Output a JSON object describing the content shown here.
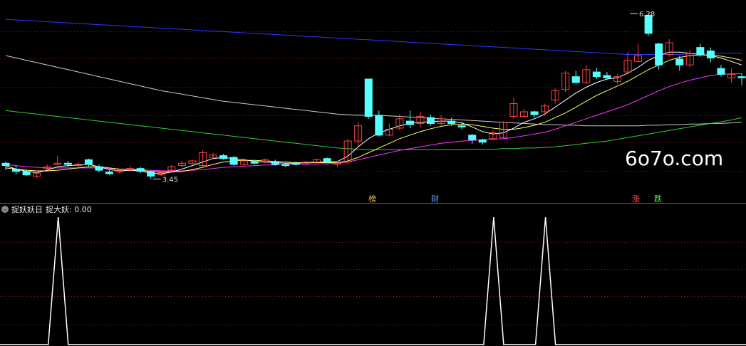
{
  "indicator": {
    "name": "捉妖妖日",
    "value_label": "捉大妖: 0.00"
  },
  "watermark": "6o7o.com",
  "tags": [
    {
      "text": "榜",
      "color": "#ffb84d"
    },
    {
      "text": "财",
      "color": "#5aa7ff"
    },
    {
      "text": "涨",
      "color": "#ff4d4d"
    },
    {
      "text": "跌",
      "color": "#4dff4d"
    }
  ],
  "colors": {
    "up": "#ff4040",
    "down": "#55ffff",
    "ma_fast": "#ffffff",
    "ma_mid": "#ffff66",
    "ma_slow": "#ff33ff",
    "ma_green": "#33cc33",
    "ma_gray": "#cccccc",
    "ma_blue": "#3333ff",
    "grid": "#8b1a1a",
    "signal": "#ffffff"
  },
  "chart_data": [
    {
      "type": "candlestick",
      "title": "",
      "y_range": [
        3.2,
        6.45
      ],
      "annotations": [
        {
          "text": "6.28",
          "value": 6.28,
          "bar": 60
        },
        {
          "text": "3.45",
          "value": 3.45,
          "bar": 14
        }
      ],
      "candles": [
        [
          3.72,
          3.68,
          3.75,
          3.6
        ],
        [
          3.62,
          3.58,
          3.68,
          3.52
        ],
        [
          3.58,
          3.52,
          3.62,
          3.5
        ],
        [
          3.5,
          3.55,
          3.6,
          3.46
        ],
        [
          3.63,
          3.66,
          3.7,
          3.6
        ],
        [
          3.7,
          3.72,
          3.85,
          3.68
        ],
        [
          3.72,
          3.7,
          3.76,
          3.66
        ],
        [
          3.68,
          3.7,
          3.74,
          3.64
        ],
        [
          3.78,
          3.7,
          3.8,
          3.66
        ],
        [
          3.66,
          3.6,
          3.7,
          3.56
        ],
        [
          3.57,
          3.54,
          3.6,
          3.52
        ],
        [
          3.57,
          3.6,
          3.62,
          3.55
        ],
        [
          3.61,
          3.63,
          3.68,
          3.58
        ],
        [
          3.63,
          3.58,
          3.66,
          3.55
        ],
        [
          3.58,
          3.5,
          3.6,
          3.45
        ],
        [
          3.52,
          3.56,
          3.6,
          3.5
        ],
        [
          3.6,
          3.66,
          3.69,
          3.58
        ],
        [
          3.68,
          3.72,
          3.76,
          3.65
        ],
        [
          3.72,
          3.76,
          3.78,
          3.7
        ],
        [
          3.68,
          3.9,
          3.94,
          3.66
        ],
        [
          3.82,
          3.86,
          3.9,
          3.8
        ],
        [
          3.85,
          3.8,
          3.88,
          3.78
        ],
        [
          3.82,
          3.7,
          3.84,
          3.68
        ],
        [
          3.7,
          3.76,
          3.8,
          3.67
        ],
        [
          3.74,
          3.72,
          3.78,
          3.7
        ],
        [
          3.76,
          3.78,
          3.8,
          3.72
        ],
        [
          3.74,
          3.7,
          3.78,
          3.68
        ],
        [
          3.7,
          3.68,
          3.73,
          3.65
        ],
        [
          3.72,
          3.7,
          3.75,
          3.68
        ],
        [
          3.72,
          3.74,
          3.76,
          3.7
        ],
        [
          3.74,
          3.78,
          3.8,
          3.72
        ],
        [
          3.8,
          3.74,
          3.82,
          3.72
        ],
        [
          3.7,
          3.72,
          3.76,
          3.65
        ],
        [
          3.74,
          4.1,
          4.14,
          3.7
        ],
        [
          4.1,
          4.36,
          4.42,
          4.0
        ],
        [
          5.16,
          4.52,
          5.16,
          4.48
        ],
        [
          4.54,
          4.2,
          4.62,
          4.18
        ],
        [
          4.2,
          4.3,
          4.4,
          4.18
        ],
        [
          4.32,
          4.48,
          4.56,
          4.28
        ],
        [
          4.44,
          4.38,
          4.62,
          4.32
        ],
        [
          4.4,
          4.52,
          4.6,
          4.34
        ],
        [
          4.5,
          4.4,
          4.55,
          4.36
        ],
        [
          4.4,
          4.48,
          4.54,
          4.36
        ],
        [
          4.44,
          4.4,
          4.5,
          4.36
        ],
        [
          4.36,
          4.34,
          4.42,
          4.3
        ],
        [
          4.2,
          4.12,
          4.22,
          4.05
        ],
        [
          4.12,
          4.08,
          4.14,
          4.04
        ],
        [
          4.14,
          4.24,
          4.28,
          4.12
        ],
        [
          4.16,
          4.42,
          4.44,
          4.14
        ],
        [
          4.52,
          4.74,
          4.84,
          4.48
        ],
        [
          4.52,
          4.6,
          4.65,
          4.5
        ],
        [
          4.6,
          4.55,
          4.62,
          4.5
        ],
        [
          4.6,
          4.7,
          4.74,
          4.56
        ],
        [
          4.8,
          4.96,
          5.0,
          4.74
        ],
        [
          4.98,
          5.26,
          5.3,
          4.94
        ],
        [
          5.2,
          5.1,
          5.3,
          5.08
        ],
        [
          5.1,
          5.32,
          5.4,
          5.08
        ],
        [
          5.28,
          5.2,
          5.35,
          5.16
        ],
        [
          5.22,
          5.18,
          5.28,
          5.14
        ],
        [
          5.12,
          5.2,
          5.24,
          5.08
        ],
        [
          5.28,
          5.48,
          5.62,
          5.24
        ],
        [
          5.46,
          5.56,
          5.76,
          5.44
        ],
        [
          6.25,
          5.94,
          6.28,
          5.9
        ],
        [
          5.76,
          5.4,
          5.78,
          5.32
        ],
        [
          5.58,
          5.78,
          5.84,
          5.54
        ],
        [
          5.5,
          5.4,
          5.56,
          5.3
        ],
        [
          5.4,
          5.6,
          5.66,
          5.36
        ],
        [
          5.7,
          5.58,
          5.76,
          5.54
        ],
        [
          5.64,
          5.52,
          5.7,
          5.44
        ],
        [
          5.34,
          5.24,
          5.4,
          5.2
        ],
        [
          5.18,
          5.24,
          5.34,
          5.1
        ],
        [
          5.2,
          5.18,
          5.26,
          5.05
        ]
      ],
      "ma_fast": [
        3.68,
        3.62,
        3.58,
        3.56,
        3.6,
        3.66,
        3.68,
        3.69,
        3.7,
        3.66,
        3.61,
        3.59,
        3.6,
        3.59,
        3.55,
        3.54,
        3.57,
        3.62,
        3.68,
        3.74,
        3.8,
        3.82,
        3.8,
        3.78,
        3.75,
        3.74,
        3.73,
        3.72,
        3.72,
        3.73,
        3.74,
        3.74,
        3.75,
        3.84,
        4.0,
        4.14,
        4.24,
        4.3,
        4.36,
        4.4,
        4.42,
        4.43,
        4.44,
        4.44,
        4.41,
        4.34,
        4.26,
        4.22,
        4.24,
        4.32,
        4.42,
        4.48,
        4.56,
        4.68,
        4.8,
        4.92,
        5.02,
        5.1,
        5.16,
        5.18,
        5.26,
        5.36,
        5.48,
        5.56,
        5.62,
        5.62,
        5.6,
        5.58,
        5.56,
        5.52,
        5.46,
        5.4
      ],
      "ma_mid": [
        3.64,
        3.62,
        3.6,
        3.59,
        3.59,
        3.6,
        3.62,
        3.64,
        3.66,
        3.66,
        3.64,
        3.62,
        3.61,
        3.6,
        3.58,
        3.57,
        3.57,
        3.58,
        3.61,
        3.65,
        3.7,
        3.74,
        3.76,
        3.77,
        3.77,
        3.76,
        3.75,
        3.74,
        3.73,
        3.73,
        3.73,
        3.73,
        3.73,
        3.76,
        3.82,
        3.9,
        3.98,
        4.06,
        4.14,
        4.2,
        4.26,
        4.31,
        4.35,
        4.38,
        4.39,
        4.38,
        4.35,
        4.32,
        4.3,
        4.3,
        4.33,
        4.37,
        4.42,
        4.5,
        4.58,
        4.68,
        4.78,
        4.88,
        4.96,
        5.04,
        5.12,
        5.22,
        5.32,
        5.4,
        5.48,
        5.53,
        5.56,
        5.57,
        5.57,
        5.55,
        5.52,
        5.48
      ],
      "ma_slow": [
        3.7,
        3.68,
        3.66,
        3.65,
        3.64,
        3.64,
        3.64,
        3.64,
        3.64,
        3.64,
        3.63,
        3.62,
        3.62,
        3.61,
        3.6,
        3.59,
        3.59,
        3.59,
        3.6,
        3.61,
        3.63,
        3.65,
        3.66,
        3.67,
        3.68,
        3.69,
        3.69,
        3.7,
        3.7,
        3.7,
        3.71,
        3.71,
        3.72,
        3.74,
        3.78,
        3.82,
        3.86,
        3.9,
        3.94,
        3.97,
        4.0,
        4.03,
        4.06,
        4.08,
        4.1,
        4.11,
        4.12,
        4.13,
        4.14,
        4.16,
        4.19,
        4.22,
        4.25,
        4.3,
        4.36,
        4.42,
        4.48,
        4.54,
        4.6,
        4.66,
        4.72,
        4.8,
        4.88,
        4.96,
        5.03,
        5.09,
        5.14,
        5.18,
        5.22,
        5.24,
        5.25,
        5.25
      ],
      "ma_green": [
        4.62,
        4.6,
        4.58,
        4.56,
        4.54,
        4.52,
        4.5,
        4.48,
        4.46,
        4.44,
        4.42,
        4.4,
        4.38,
        4.36,
        4.34,
        4.32,
        4.3,
        4.28,
        4.26,
        4.24,
        4.22,
        4.2,
        4.18,
        4.16,
        4.14,
        4.12,
        4.1,
        4.08,
        4.06,
        4.04,
        4.02,
        4.0,
        3.98,
        3.97,
        3.96,
        3.95,
        3.95,
        3.95,
        3.95,
        3.95,
        3.95,
        3.95,
        3.95,
        3.95,
        3.95,
        3.96,
        3.96,
        3.96,
        3.97,
        3.97,
        3.98,
        3.98,
        3.99,
        4.0,
        4.02,
        4.04,
        4.06,
        4.08,
        4.1,
        4.13,
        4.16,
        4.19,
        4.22,
        4.25,
        4.28,
        4.31,
        4.34,
        4.37,
        4.4,
        4.43,
        4.46,
        4.5
      ],
      "ma_gray": [
        5.56,
        5.52,
        5.48,
        5.44,
        5.4,
        5.36,
        5.32,
        5.28,
        5.24,
        5.2,
        5.16,
        5.12,
        5.08,
        5.04,
        5.0,
        4.96,
        4.93,
        4.9,
        4.87,
        4.84,
        4.81,
        4.78,
        4.76,
        4.74,
        4.72,
        4.7,
        4.68,
        4.66,
        4.64,
        4.62,
        4.6,
        4.58,
        4.56,
        4.55,
        4.54,
        4.54,
        4.54,
        4.53,
        4.52,
        4.51,
        4.5,
        4.49,
        4.48,
        4.47,
        4.46,
        4.45,
        4.44,
        4.43,
        4.42,
        4.41,
        4.4,
        4.39,
        4.38,
        4.38,
        4.37,
        4.37,
        4.36,
        4.36,
        4.36,
        4.36,
        4.36,
        4.36,
        4.37,
        4.37,
        4.38,
        4.38,
        4.39,
        4.39,
        4.4,
        4.4,
        4.41,
        4.42
      ],
      "ma_blue": [
        6.18,
        6.17,
        6.16,
        6.15,
        6.14,
        6.13,
        6.12,
        6.11,
        6.1,
        6.09,
        6.08,
        6.07,
        6.06,
        6.05,
        6.04,
        6.03,
        6.02,
        6.01,
        6.0,
        5.99,
        5.98,
        5.97,
        5.96,
        5.95,
        5.94,
        5.93,
        5.92,
        5.91,
        5.9,
        5.89,
        5.88,
        5.87,
        5.86,
        5.85,
        5.84,
        5.83,
        5.82,
        5.81,
        5.8,
        5.79,
        5.78,
        5.77,
        5.76,
        5.75,
        5.74,
        5.73,
        5.72,
        5.71,
        5.7,
        5.69,
        5.68,
        5.67,
        5.66,
        5.65,
        5.64,
        5.63,
        5.62,
        5.61,
        5.6,
        5.59,
        5.58,
        5.58,
        5.58,
        5.58,
        5.58,
        5.58,
        5.59,
        5.59,
        5.6,
        5.6,
        5.6,
        5.6
      ]
    },
    {
      "type": "line",
      "title": "捉妖妖日",
      "series_name": "捉大妖",
      "y_range": [
        0,
        1
      ],
      "signal_bars": [
        5,
        47,
        52
      ]
    }
  ]
}
